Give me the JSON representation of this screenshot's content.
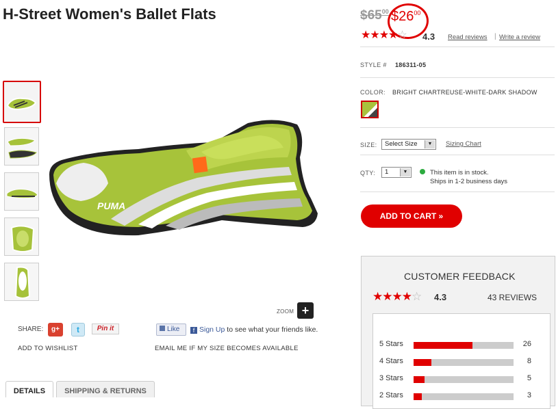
{
  "product": {
    "title": "H-Street Women's Ballet Flats",
    "brand_tag": "PUMA"
  },
  "gallery": {
    "zoom_label": "ZOOM",
    "zoom_icon": "plus-icon"
  },
  "share": {
    "label": "SHARE:",
    "gplus": "g+",
    "twitter": "t",
    "pinterest": "Pin it",
    "fb_like": "Like",
    "fb_signup_link": "Sign Up",
    "fb_signup_text": " to see what your friends like."
  },
  "links": {
    "wishlist": "ADD TO WISHLIST",
    "email_me": "EMAIL ME IF MY SIZE BECOMES AVAILABLE"
  },
  "tabs": [
    {
      "label": "DETAILS"
    },
    {
      "label": "SHIPPING & RETURNS"
    }
  ],
  "price": {
    "old_whole": "$65",
    "old_cents": "00",
    "new_whole": "$26",
    "new_cents": "00",
    "highlight_color": "#e00000"
  },
  "rating": {
    "value": "4.3",
    "stars": 4.3,
    "read_reviews": "Read reviews",
    "separator": "|",
    "write_review": "Write a review"
  },
  "style": {
    "label": "STYLE #",
    "value": "186311-05"
  },
  "color": {
    "label": "COLOR:",
    "value": "BRIGHT CHARTREUSE-WHITE-DARK SHADOW"
  },
  "size": {
    "label": "SIZE:",
    "selected": "Select Size",
    "sizing_chart": "Sizing Chart"
  },
  "qty": {
    "label": "QTY:",
    "selected": "1"
  },
  "stock": {
    "line1": "This item is in stock.",
    "line2": "Ships in 1-2 business days",
    "dot_color": "#2cab3f"
  },
  "cart": {
    "label": "ADD TO CART  »"
  },
  "feedback": {
    "title": "CUSTOMER FEEDBACK",
    "rating": "4.3",
    "reviews": "43 REVIEWS",
    "breakdown": [
      {
        "label": "5 Stars",
        "count": "26",
        "fraction": 0.59
      },
      {
        "label": "4 Stars",
        "count": "8",
        "fraction": 0.18
      },
      {
        "label": "3 Stars",
        "count": "5",
        "fraction": 0.11
      },
      {
        "label": "2 Stars",
        "count": "3",
        "fraction": 0.08
      }
    ]
  }
}
